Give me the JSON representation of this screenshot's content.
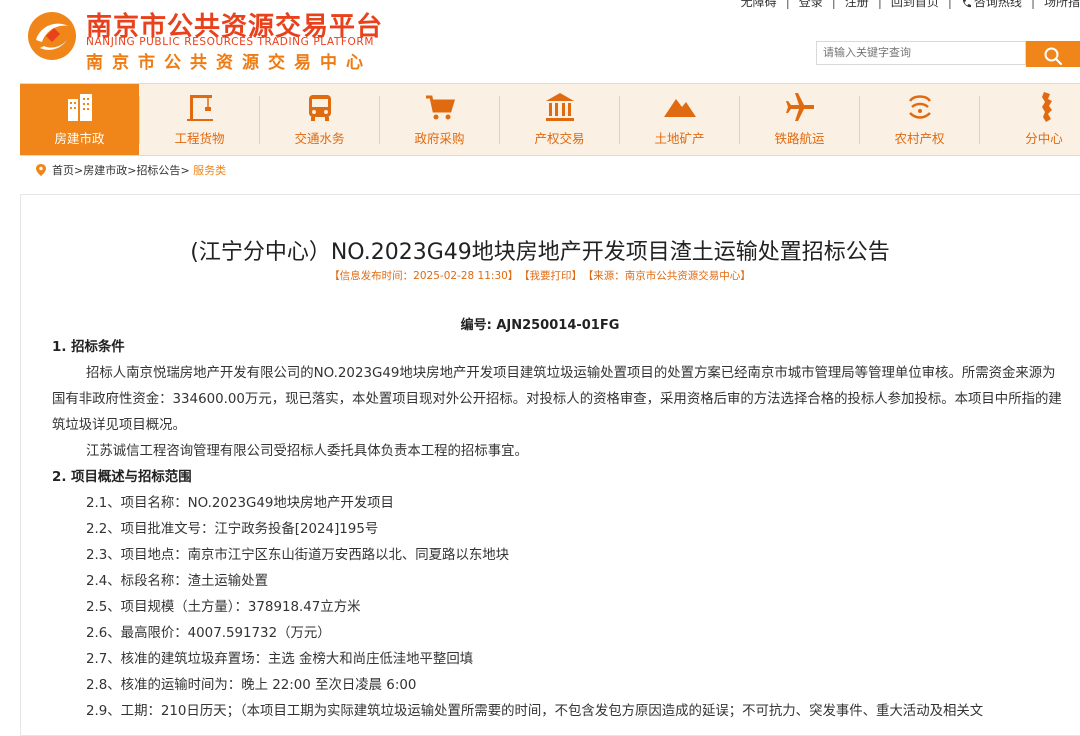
{
  "header": {
    "title_cn": "南京市公共资源交易平台",
    "title_en": "NANJING PUBLIC RESOURCES TRADING PLATFORM",
    "subtitle_cn": "南京市公共资源交易中心",
    "top_links": [
      "无障碍",
      "登录",
      "注册",
      "回到首页",
      "咨询热线",
      "场所指"
    ],
    "search_placeholder": "请输入关键字查询"
  },
  "nav": {
    "items": [
      {
        "label": "房建市政",
        "icon": "building-icon",
        "active": true
      },
      {
        "label": "工程货物",
        "icon": "crane-icon",
        "active": false
      },
      {
        "label": "交通水务",
        "icon": "bus-icon",
        "active": false
      },
      {
        "label": "政府采购",
        "icon": "cart-icon",
        "active": false
      },
      {
        "label": "产权交易",
        "icon": "bank-icon",
        "active": false
      },
      {
        "label": "土地矿产",
        "icon": "mountain-icon",
        "active": false
      },
      {
        "label": "铁路航运",
        "icon": "plane-icon",
        "active": false
      },
      {
        "label": "农村产权",
        "icon": "farm-icon",
        "active": false
      },
      {
        "label": "分中心",
        "icon": "map-icon",
        "active": false
      }
    ]
  },
  "breadcrumb": {
    "items": [
      "首页",
      "房建市政",
      "招标公告"
    ],
    "current": "服务类"
  },
  "article": {
    "title": "(江宁分中心）NO.2023G49地块房地产开发项目渣土运输处置招标公告",
    "meta_date": "【信息发布时间：2025-02-28 11:30】",
    "meta_print": "【我要打印】",
    "meta_source": "【来源：南京市公共资源交易中心】",
    "number": "编号: AJN250014-01FG",
    "section1_title": "1. 招标条件",
    "section1_p1": "招标人南京悦瑞房地产开发有限公司的NO.2023G49地块房地产开发项目建筑垃圾运输处置项目的处置方案已经南京市城市管理局等管理单位审核。所需资金来源为国有非政府性资金：334600.00万元，现已落实，本处置项目现对外公开招标。对投标人的资格审查，采用资格后审的方法选择合格的投标人参加投标。本项目中所指的建筑垃圾详见项目概况。",
    "section1_p2": "江苏诚信工程咨询管理有限公司受招标人委托具体负责本工程的招标事宜。",
    "section2_title": "2. 项目概述与招标范围",
    "section2_items": [
      "2.1、项目名称：NO.2023G49地块房地产开发项目",
      "2.2、项目批准文号：江宁政务投备[2024]195号",
      "2.3、项目地点：南京市江宁区东山街道万安西路以北、同夏路以东地块",
      "2.4、标段名称：渣土运输处置",
      "2.5、项目规模（土方量）：378918.47立方米",
      "2.6、最高限价：4007.591732（万元）",
      "2.7、核准的建筑垃圾弃置场：主选 金榜大和尚庄低洼地平整回填",
      "2.8、核准的运输时间为：晚上 22:00 至次日凌晨 6:00",
      "2.9、工期：210日历天；（本项目工期为实际建筑垃圾运输处置所需要的时间，不包含发包方原因造成的延误；不可抗力、突发事件、重大活动及相关文"
    ]
  },
  "colors": {
    "brand_red": "#e8411c",
    "brand_orange": "#f08519",
    "nav_bg": "#fbf0e4"
  }
}
